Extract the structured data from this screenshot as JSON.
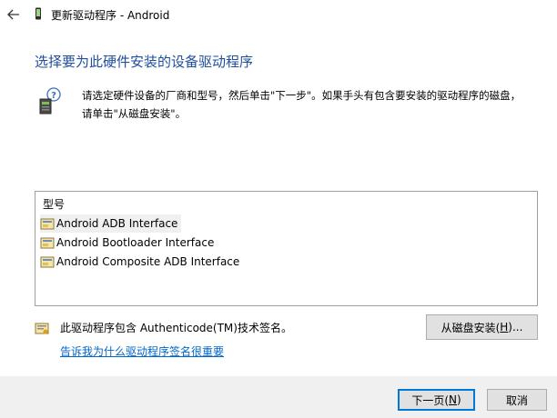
{
  "window": {
    "title": "更新驱动程序 - Android"
  },
  "heading": "选择要为此硬件安装的设备驱动程序",
  "instruction": {
    "line1": "请选定硬件设备的厂商和型号，然后单击\"下一步\"。如果手头有包含要安装的驱动程序的磁盘，",
    "line2": "请单击\"从磁盘安装\"。"
  },
  "model_list": {
    "header": "型号",
    "items": [
      {
        "label": "Android ADB Interface",
        "selected": true
      },
      {
        "label": "Android Bootloader Interface",
        "selected": false
      },
      {
        "label": "Android Composite ADB Interface",
        "selected": false
      }
    ]
  },
  "signature": {
    "text": "此驱动程序包含 Authenticode(TM)技术签名。",
    "link": "告诉我为什么驱动程序签名很重要"
  },
  "buttons": {
    "have_disk_prefix": "从磁盘安装(",
    "have_disk_key": "H",
    "have_disk_suffix": ")...",
    "next_prefix": "下一页(",
    "next_key": "N",
    "next_suffix": ")",
    "cancel": "取消"
  },
  "colors": {
    "heading": "#1f4e9c",
    "link": "#0066cc",
    "footer_bg": "#f0f0f0",
    "default_button_border": "#0078d7"
  },
  "icons": {
    "back": "back-arrow-icon",
    "title": "device-icon",
    "wizard": "hardware-help-icon",
    "driver": "driver-package-icon",
    "signature": "certificate-icon"
  }
}
